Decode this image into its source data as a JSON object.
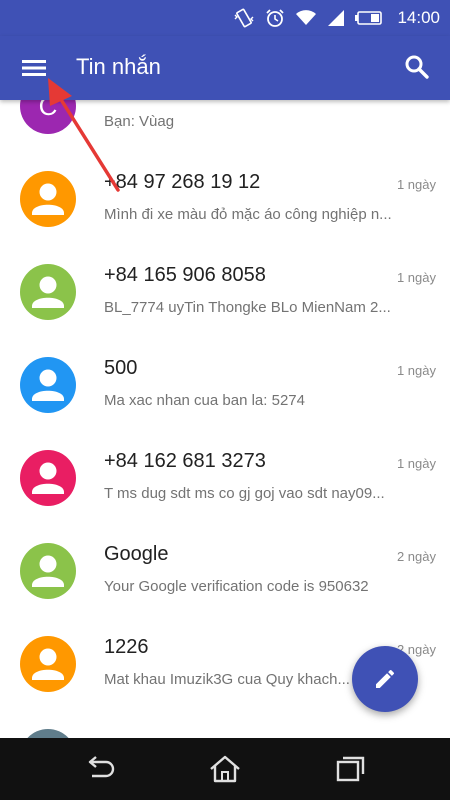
{
  "status_bar": {
    "time": "14:00",
    "icons": [
      "vibrate-icon",
      "alarm-icon",
      "wifi-icon",
      "signal-icon",
      "battery-icon"
    ]
  },
  "toolbar": {
    "title": "Tin nhắn",
    "menu_icon": "hamburger-menu-icon",
    "search_icon": "search-icon"
  },
  "conversations": [
    {
      "avatar_letter": "C",
      "avatar_color": "#9c27b0",
      "name": "",
      "time": "",
      "snippet": "Bạn: Vùag"
    },
    {
      "avatar_color": "#ff9800",
      "name": "+84 97 268 19 12",
      "time": "1 ngày",
      "snippet": "Mình đi xe màu đỏ mặc áo công nghiệp n..."
    },
    {
      "avatar_color": "#8bc34a",
      "name": "+84 165 906 8058",
      "time": "1 ngày",
      "snippet": "BL_7774  uyTin Thongke BLo MienNam 2..."
    },
    {
      "avatar_color": "#2196f3",
      "name": "500",
      "time": "1 ngày",
      "snippet": "Ma xac nhan cua ban la: 5274"
    },
    {
      "avatar_color": "#e91e63",
      "name": "+84 162 681 3273",
      "time": "1 ngày",
      "snippet": "T ms dug sdt ms co gj goj vao sdt nay09..."
    },
    {
      "avatar_color": "#8bc34a",
      "name": "Google",
      "time": "2 ngày",
      "snippet": "Your Google verification code is 950632"
    },
    {
      "avatar_color": "#ff9800",
      "name": "1226",
      "time": "2 ngày",
      "snippet": "Mat khau Imuzik3G cua Quy khach..."
    },
    {
      "avatar_color": "#607d8b",
      "name": "",
      "time": "",
      "snippet": ""
    }
  ],
  "fab": {
    "icon": "pencil-icon",
    "color": "#3f51b5"
  },
  "annotation": {
    "icon": "red-arrow-icon",
    "color": "#e53935"
  },
  "nav_bar": {
    "icons": [
      "back-icon",
      "home-icon",
      "recent-apps-icon"
    ]
  },
  "colors": {
    "primary": "#3f51b5",
    "text_primary": "#212121",
    "text_secondary": "#737373"
  }
}
